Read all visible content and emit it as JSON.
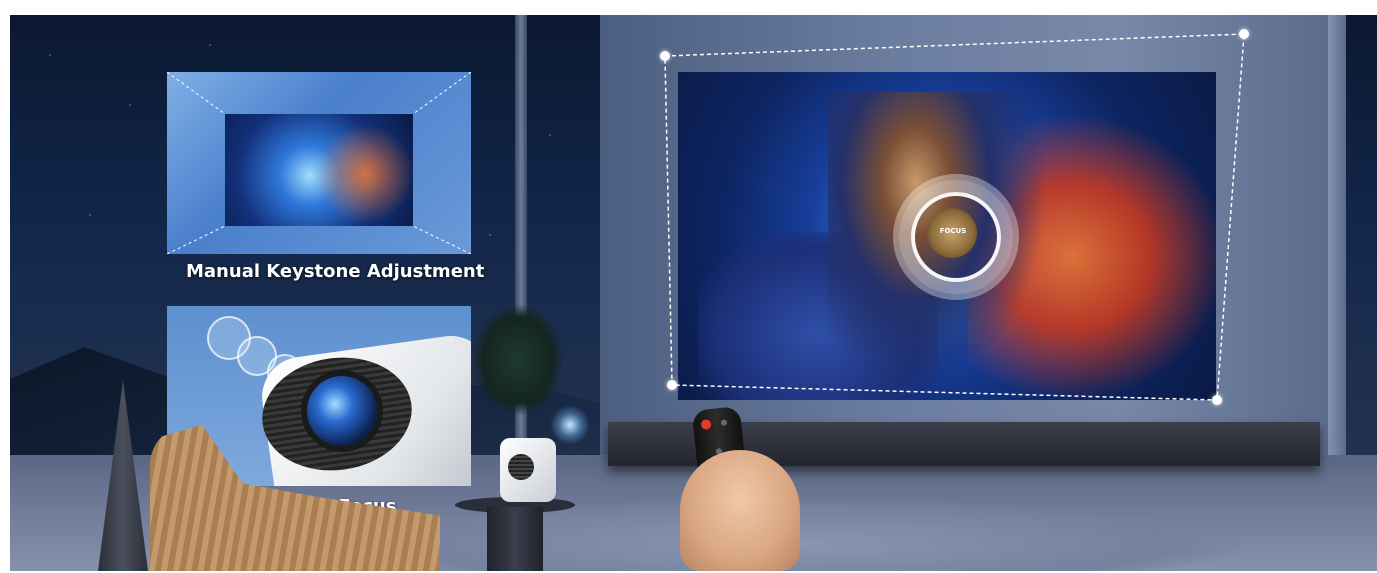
{
  "scene": {
    "labels": {
      "keystone": "Manual Keystone Adjustment",
      "focus": "Manual Focus",
      "focus_badge": "FOCUS"
    }
  }
}
